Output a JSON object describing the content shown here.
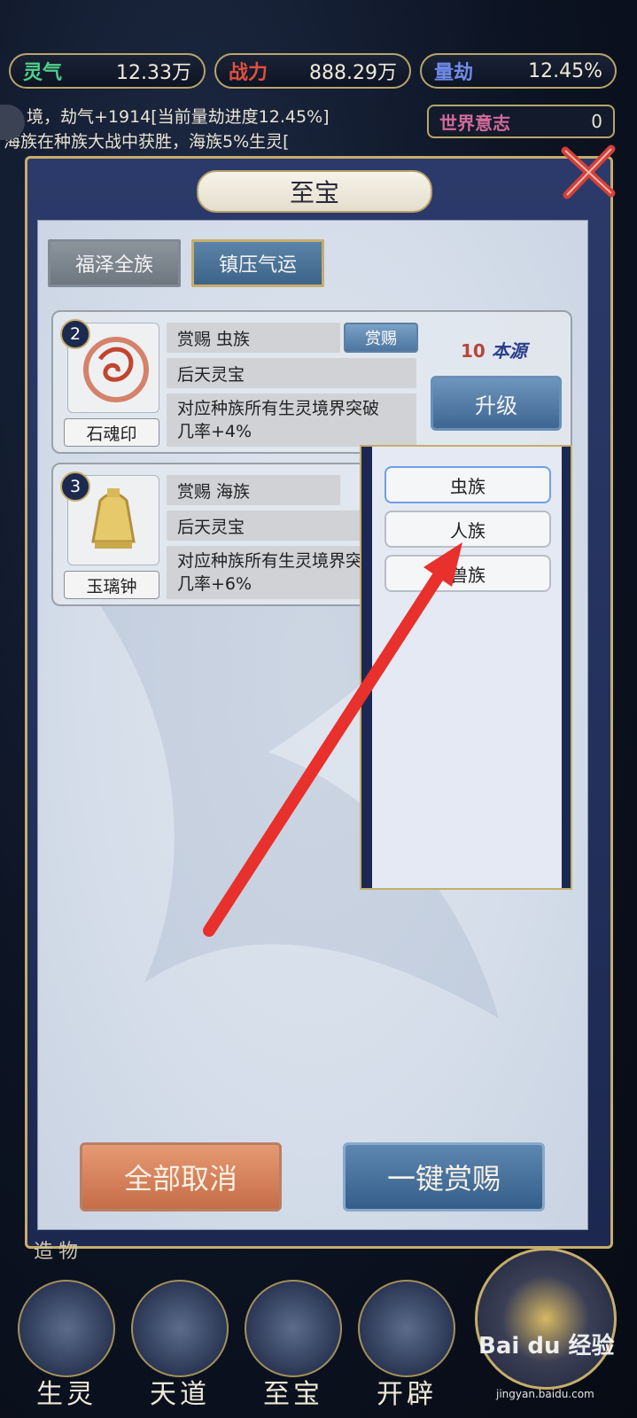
{
  "stats": [
    {
      "label": "灵气",
      "value": "12.33万",
      "label_color": "#4fd08a"
    },
    {
      "label": "战力",
      "value": "888.29万",
      "label_color": "#e0503f"
    },
    {
      "label": "量劫",
      "value": "12.45%",
      "label_color": "#6f8be8"
    }
  ],
  "log": {
    "line1": "境，劫气+1914[当前量劫进度12.45%]",
    "line2": "海族在种族大战中获胜，海族5%生灵["
  },
  "world_will": {
    "label": "世界意志",
    "value": "0"
  },
  "dialog": {
    "title": "至宝",
    "tabs": [
      "福泽全族",
      "镇压气运"
    ],
    "cards": [
      {
        "index": "2",
        "name": "石魂印",
        "reward_text": "赏赐  虫族",
        "reward_button": "赏赐",
        "grade": "后天灵宝",
        "desc_line1": "对应种族所有生灵境界突破",
        "desc_line2": "几率+4%",
        "cost_amount": "10",
        "cost_unit": "本源",
        "upgrade_button": "升级"
      },
      {
        "index": "3",
        "name": "玉璃钟",
        "reward_text": "赏赐  海族",
        "grade": "后天灵宝",
        "desc_line1": "对应种族所有生灵境界突破",
        "desc_line2": "几率+6%"
      }
    ],
    "dropdown_options": [
      "虫族",
      "人族",
      "兽族"
    ],
    "cancel_all": "全部取消",
    "reward_all": "一键赏赐"
  },
  "side_label": "造物",
  "nav": [
    "生灵",
    "天道",
    "至宝",
    "开辟"
  ],
  "watermark": {
    "logo": "Bai du 经验",
    "url": "jingyan.baidu.com"
  },
  "colors": {
    "accent_gold": "#c7ad6b",
    "arrow_red": "#e8302c"
  }
}
